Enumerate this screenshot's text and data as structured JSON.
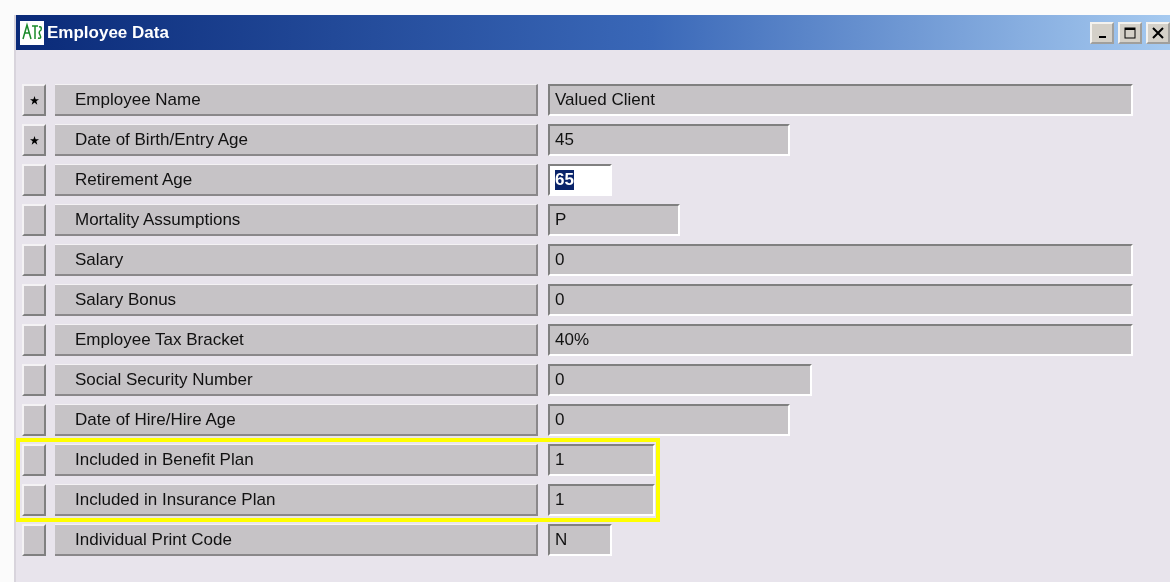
{
  "window": {
    "title": "Employee Data"
  },
  "fields": [
    {
      "label": "Employee Name",
      "value": "Valued Client",
      "required": true,
      "focused": false,
      "highlighted": false
    },
    {
      "label": "Date of Birth/Entry Age",
      "value": "45",
      "required": true,
      "focused": false,
      "highlighted": false
    },
    {
      "label": "Retirement Age",
      "value": "65",
      "required": false,
      "focused": true,
      "highlighted": false
    },
    {
      "label": "Mortality Assumptions",
      "value": "P",
      "required": false,
      "focused": false,
      "highlighted": false
    },
    {
      "label": "Salary",
      "value": "0",
      "required": false,
      "focused": false,
      "highlighted": false
    },
    {
      "label": "Salary Bonus",
      "value": "0",
      "required": false,
      "focused": false,
      "highlighted": false
    },
    {
      "label": "Employee Tax Bracket",
      "value": "40%",
      "required": false,
      "focused": false,
      "highlighted": false
    },
    {
      "label": "Social Security Number",
      "value": "0",
      "required": false,
      "focused": false,
      "highlighted": false
    },
    {
      "label": "Date of Hire/Hire Age",
      "value": "0",
      "required": false,
      "focused": false,
      "highlighted": false
    },
    {
      "label": "Included in Benefit Plan",
      "value": "1",
      "required": false,
      "focused": false,
      "highlighted": true
    },
    {
      "label": "Included in Insurance Plan",
      "value": "1",
      "required": false,
      "focused": false,
      "highlighted": true
    },
    {
      "label": "Individual Print Code",
      "value": "N",
      "required": false,
      "focused": false,
      "highlighted": false
    }
  ]
}
